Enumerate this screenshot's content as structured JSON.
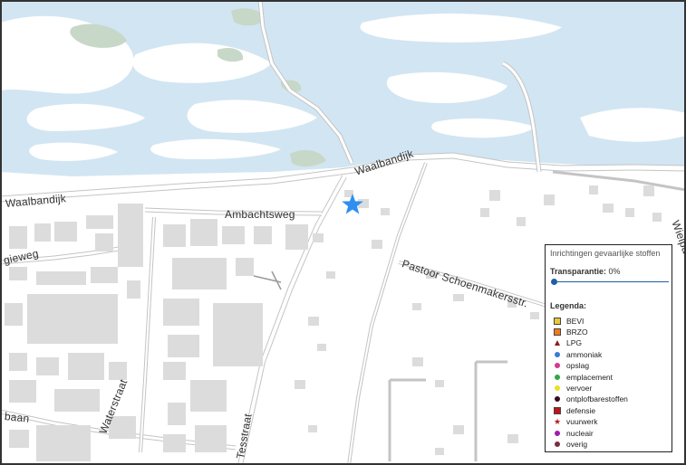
{
  "map": {
    "streets": [
      "Waalbandijk",
      "Waalbandijk",
      "Ambachtsweg",
      "gieweg",
      "Pastoor Schoenmakersstr.",
      "Waterstraat",
      "Tesstraat",
      "baan",
      "Wielpad"
    ],
    "marker": "location-star-icon",
    "colors": {
      "water": "#d2e5f2",
      "vegetation": "#c8d8c8",
      "building": "#dcdcdc",
      "road": "#c4c4c4",
      "marker": "#2f8ff0"
    }
  },
  "legend": {
    "title": "Inrichtingen gevaarlijke stoffen",
    "transparency_label": "Transparantie:",
    "transparency_value": "0%",
    "transparency_level": 0,
    "legend_heading": "Legenda:",
    "items": [
      {
        "label": "BEVI",
        "color": "#e8c73a",
        "symbol": "square"
      },
      {
        "label": "BRZO",
        "color": "#f07d1a",
        "symbol": "square"
      },
      {
        "label": "LPG",
        "color": "#8b1a1a",
        "symbol": "triangle"
      },
      {
        "label": "ammoniak",
        "color": "#3b7ad6",
        "symbol": "circle"
      },
      {
        "label": "opslag",
        "color": "#d23a8c",
        "symbol": "circle"
      },
      {
        "label": "emplacement",
        "color": "#2fa84a",
        "symbol": "circle"
      },
      {
        "label": "vervoer",
        "color": "#e8e02a",
        "symbol": "circle"
      },
      {
        "label": "ontplofbarestoffen",
        "color": "#3a0a20",
        "symbol": "circle"
      },
      {
        "label": "defensie",
        "color": "#c0151b",
        "symbol": "square"
      },
      {
        "label": "vuurwerk",
        "color": "#b21f1f",
        "symbol": "star"
      },
      {
        "label": "nucleair",
        "color": "#9b1fb2",
        "symbol": "circle"
      },
      {
        "label": "overig",
        "color": "#7a2e3e",
        "symbol": "circle"
      }
    ]
  }
}
